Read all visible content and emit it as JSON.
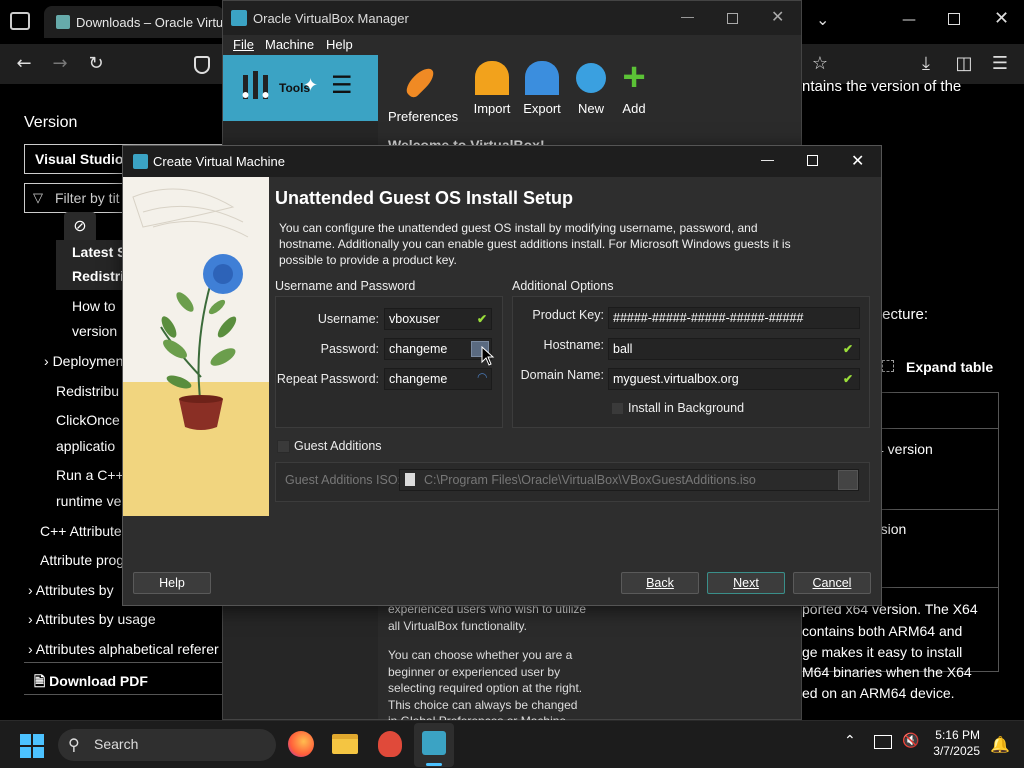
{
  "browser": {
    "tab_title": "Downloads – Oracle VirtualB",
    "sidebar": {
      "version_heading": "Version",
      "version_select": "Visual Studio",
      "filter_placeholder": "Filter by tit",
      "items": [
        {
          "label": "Latest S"
        },
        {
          "label": "Redistrit"
        },
        {
          "label": "How to"
        },
        {
          "label": "version"
        },
        {
          "label": "Deploymen"
        },
        {
          "label": "Redistribu"
        },
        {
          "label": "ClickOnce"
        },
        {
          "label": "applicatio"
        },
        {
          "label": "Run a C++"
        },
        {
          "label": "runtime ve"
        },
        {
          "label": "C++ Attribute"
        },
        {
          "label": "Attribute prog"
        },
        {
          "label": "Attributes by"
        },
        {
          "label": "Attributes by usage"
        },
        {
          "label": "Attributes alphabetical referer"
        }
      ],
      "download_pdf": "Download PDF"
    },
    "right": {
      "line1": "ntains the version of the",
      "line2": "tecture:",
      "expand_table": "Expand table",
      "cell1": "4 version",
      "cell2": "rsion",
      "para1": "ported x64 version. The X64",
      "para2": "contains both ARM64 and",
      "para3": "ge makes it easy to install",
      "para4": "M64 binaries when the X64",
      "para5": "ed on an ARM64 device."
    }
  },
  "vbox_manager": {
    "title": "Oracle VirtualBox Manager",
    "menu": [
      "File",
      "Machine",
      "Help"
    ],
    "tools_label": "Tools",
    "toolbar": [
      {
        "label": "Preferences",
        "icon": "wrench-icon",
        "color": "#f08a24"
      },
      {
        "label": "Import",
        "icon": "import-icon",
        "color": "#f2a21c"
      },
      {
        "label": "Export",
        "icon": "export-icon",
        "color": "#3b8ede"
      },
      {
        "label": "New",
        "icon": "new-icon",
        "color": "#3aa0e0"
      },
      {
        "label": "Add",
        "icon": "add-icon",
        "color": "#5bc236"
      }
    ],
    "welcome": "Welcome to VirtualBox!",
    "body_lines_1": [
      "experienced users who wish to utilize",
      "all VirtualBox functionality."
    ],
    "body_lines_2": [
      "You can choose whether you are a",
      "beginner or experienced user by",
      "selecting required option at the right.",
      "This choice can always be changed",
      "in Global Preferences or Machine"
    ]
  },
  "dialog": {
    "title": "Create Virtual Machine",
    "heading": "Unattended Guest OS Install Setup",
    "intro": "You can configure the unattended guest OS install by modifying username, password, and hostname. Additionally you can enable guest additions install. For Microsoft Windows guests it is possible to provide a product key.",
    "userpass": {
      "group_title": "Username and Password",
      "username_label": "Username:",
      "username_value": "vboxuser",
      "password_label": "Password:",
      "password_value": "changeme",
      "repeat_label": "Repeat Password:",
      "repeat_value": "changeme"
    },
    "additional": {
      "group_title": "Additional Options",
      "product_key_label": "Product Key:",
      "product_key_value": "#####-#####-#####-#####-#####",
      "hostname_label": "Hostname:",
      "hostname_value": "ball",
      "domain_label": "Domain Name:",
      "domain_value": "myguest.virtualbox.org",
      "install_bg_label": "Install in Background"
    },
    "guest_additions": {
      "checkbox_label": "Guest Additions",
      "iso_label": "Guest Additions ISO:",
      "iso_value": "C:\\Program Files\\Oracle\\VirtualBox\\VBoxGuestAdditions.iso"
    },
    "buttons": {
      "help": "Help",
      "back": "Back",
      "next": "Next",
      "cancel": "Cancel"
    }
  },
  "taskbar": {
    "search": "Search",
    "time": "5:16 PM",
    "date": "3/7/2025"
  },
  "colors": {
    "accent_teal": "#3ba3c4",
    "check_green": "#9ade3a",
    "dialog_bg": "#2e2e2e"
  }
}
